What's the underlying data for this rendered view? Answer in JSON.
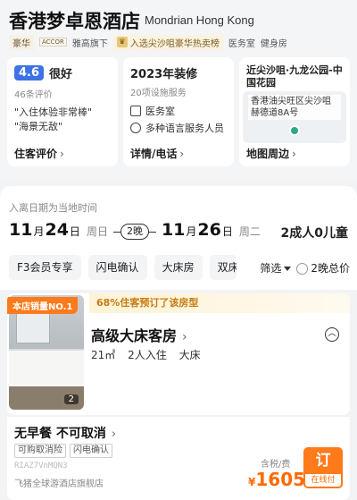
{
  "hotel": {
    "name": "香港梦卓恩酒店",
    "name_en": "Mondrian Hong Kong"
  },
  "tags": {
    "level": "豪华",
    "brand_logo": "ACCOR",
    "brand": "雅高旗下",
    "award": "入选尖沙咀豪华热卖榜",
    "facility1": "医务室",
    "facility2": "健身房"
  },
  "review": {
    "score": "4.6",
    "rating_text": "很好",
    "count": "46条评价",
    "quote1": "\"入住体验非常棒\"",
    "quote2": "\"海景无敌\"",
    "link": "住客评价"
  },
  "info": {
    "renovation": "2023年装修",
    "facilities_count": "20项设施服务",
    "facility1": "医务室",
    "facility2": "多种语言服务人员",
    "link": "详情/电话"
  },
  "location": {
    "title": "近尖沙咀·九龙公园-中国花园",
    "address": "香港油尖旺区尖沙咀赫德道8A号",
    "link": "地图周边"
  },
  "booking": {
    "notice": "入离日期为当地时间",
    "checkin_day": "11",
    "checkin_date": "24",
    "checkin_weekday": "周日",
    "nights": "2晚",
    "checkout_day": "11",
    "checkout_date": "26",
    "checkout_weekday": "周二",
    "month_unit": "月",
    "day_unit": "日",
    "guests": "2成人0儿童"
  },
  "filters": {
    "chips": [
      "F3会员专享",
      "闪电确认",
      "大床房",
      "双床"
    ],
    "filter_label": "筛选",
    "total_price_label": "2晚总价"
  },
  "room": {
    "sales_badge": "本店销量NO.1",
    "promo": "68%住客预订了该房型",
    "name": "高级大床客房",
    "area": "21㎡",
    "occupancy": "2人入住",
    "bed": "大床",
    "photo_count": "2"
  },
  "rate": {
    "title": "无早餐 不可取消",
    "tags": [
      "可购取消险",
      "闪电确认"
    ],
    "code": "RIAZ7VnMQN3",
    "shop": "飞猪全球游酒店旗舰店",
    "tax_label": "含税/费",
    "currency": "¥",
    "price": "1605",
    "book_label": "订",
    "pay_label": "在线付"
  },
  "colors": {
    "accent_orange": "#ff7a1a",
    "score_blue": "#3d72e6",
    "price_orange": "#ff6a00"
  }
}
